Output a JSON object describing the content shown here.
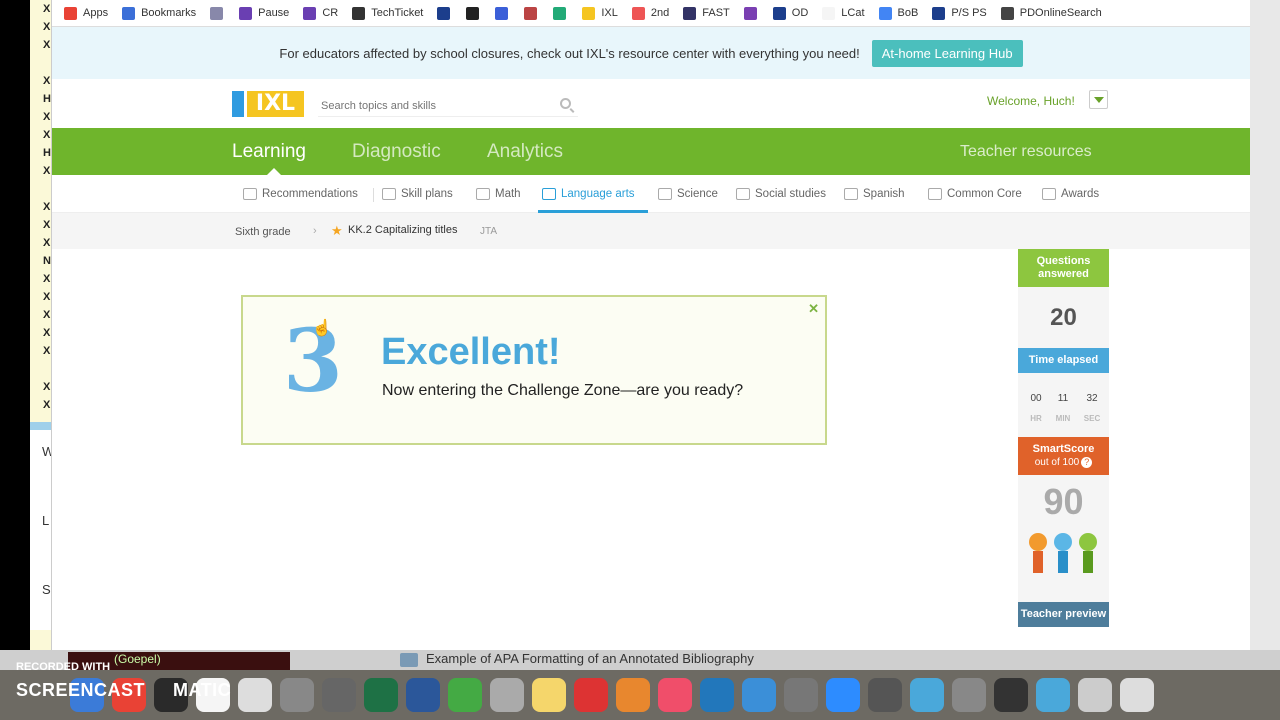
{
  "bookmarks": [
    {
      "label": "Apps",
      "icon": "apps-grid-icon",
      "color": "#e94235"
    },
    {
      "label": "Bookmarks",
      "icon": "star-icon",
      "color": "#3b6fd8"
    },
    {
      "label": "",
      "icon": "microscope-icon",
      "color": "#88a"
    },
    {
      "label": "Pause",
      "icon": "doc-icon",
      "color": "#6a3fb2"
    },
    {
      "label": "CR",
      "icon": "doc-icon",
      "color": "#6a3fb2"
    },
    {
      "label": "TechTicket",
      "icon": "ninja-icon",
      "color": "#333"
    },
    {
      "label": "",
      "icon": "p-icon",
      "color": "#1c3e8c"
    },
    {
      "label": "",
      "icon": "s-icon",
      "color": "#222"
    },
    {
      "label": "",
      "icon": "c-icon",
      "color": "#3b5fd8"
    },
    {
      "label": "",
      "icon": "grid-icon",
      "color": "#b44"
    },
    {
      "label": "",
      "icon": "pen-icon",
      "color": "#2a7"
    },
    {
      "label": "IXL",
      "icon": "ixl-icon",
      "color": "#f5c521"
    },
    {
      "label": "2nd",
      "icon": "doc-icon",
      "color": "#e55"
    },
    {
      "label": "FAST",
      "icon": "chevron-icon",
      "color": "#336"
    },
    {
      "label": "",
      "icon": "f-icon",
      "color": "#7a3fb2"
    },
    {
      "label": "OD",
      "icon": "r-icon",
      "color": "#1c3e8c"
    },
    {
      "label": "LCat",
      "icon": "lc-icon",
      "color": "#f5f5f5"
    },
    {
      "label": "BoB",
      "icon": "google-icon",
      "color": "#4285f4"
    },
    {
      "label": "P/S PS",
      "icon": "p-icon",
      "color": "#1c3e8c"
    },
    {
      "label": "PDOnlineSearch",
      "icon": "globe-icon",
      "color": "#444"
    }
  ],
  "banner": {
    "text": "For educators affected by school closures, check out IXL's resource center with everything you need!",
    "button": "At-home Learning Hub"
  },
  "header": {
    "logo": "IXL",
    "search_placeholder": "Search topics and skills",
    "welcome": "Welcome, Huch!"
  },
  "nav": {
    "items": [
      "Learning",
      "Diagnostic",
      "Analytics"
    ],
    "teacher_resources": "Teacher resources"
  },
  "subnav": {
    "items": [
      "Recommendations",
      "Skill plans",
      "Math",
      "Language arts",
      "Science",
      "Social studies",
      "Spanish",
      "Common Core",
      "Awards"
    ],
    "active": "Language arts"
  },
  "breadcrumb": {
    "grade": "Sixth grade",
    "skill": "KK.2 Capitalizing titles",
    "code": "JTA"
  },
  "feedback": {
    "number": "3",
    "title": "Excellent!",
    "message": "Now entering the Challenge Zone—are you ready?"
  },
  "stats": {
    "questions_label": "Questions answered",
    "questions_value": "20",
    "time_label": "Time elapsed",
    "time_hr": "00",
    "time_min": "11",
    "time_sec": "32",
    "hr_label": "HR",
    "min_label": "MIN",
    "sec_label": "SEC",
    "smartscore_label": "SmartScore",
    "smartscore_sub": "out of 100",
    "smartscore_value": "90",
    "teacher_preview": "Teacher preview"
  },
  "taskbar": {
    "gospel": "(Goepel)",
    "doc_title": "Example of APA Formatting of an Annotated Bibliography",
    "recorded": "RECORDED WITH",
    "brand": "SCREENCAST",
    "brand_suffix": "MATIC"
  },
  "background_window": {
    "chars": [
      "X",
      "X",
      "X",
      "",
      "X",
      "H",
      "X",
      "X",
      "H",
      "X",
      "",
      "X",
      "X",
      "X",
      "N",
      "X",
      "X",
      "X",
      "X",
      "X",
      "",
      "X",
      "X"
    ],
    "side_letters": [
      "W",
      "L",
      "S"
    ]
  },
  "colors": {
    "green": "#6fb52c",
    "blue": "#4aa8da",
    "orange": "#e0622a",
    "teal": "#4bbfbd"
  }
}
